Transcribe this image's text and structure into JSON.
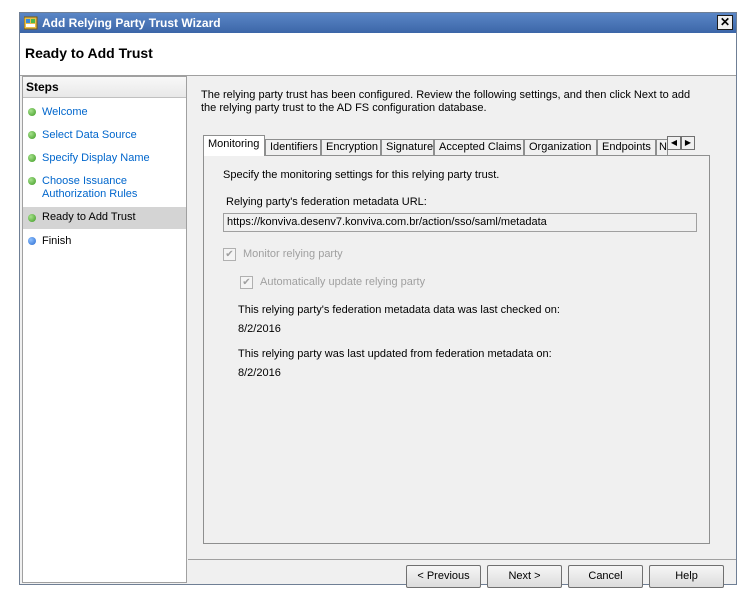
{
  "window": {
    "title": "Add Relying Party Trust Wizard",
    "close_glyph": "✕",
    "icon": "wizard-icon"
  },
  "header": {
    "title": "Ready to Add Trust"
  },
  "steps": {
    "heading": "Steps",
    "items": [
      {
        "label": "Welcome",
        "status": "done"
      },
      {
        "label": "Select Data Source",
        "status": "done"
      },
      {
        "label": "Specify Display Name",
        "status": "done"
      },
      {
        "label": "Choose Issuance\nAuthorization Rules",
        "status": "done"
      },
      {
        "label": "Ready to Add Trust",
        "status": "current"
      },
      {
        "label": "Finish",
        "status": "pending"
      }
    ]
  },
  "main": {
    "intro": "The relying party trust has been configured. Review the following settings, and then click Next to add the relying party trust to the AD FS configuration database.",
    "tabs": [
      "Monitoring",
      "Identifiers",
      "Encryption",
      "Signature",
      "Accepted Claims",
      "Organization",
      "Endpoints",
      "N"
    ],
    "selected_tab": "Monitoring",
    "tab_scroll_left": "◀",
    "tab_scroll_right": "▶",
    "monitoring": {
      "description": "Specify the monitoring settings for this relying party trust.",
      "url_label": "Relying party's federation metadata URL:",
      "url_value": "https://konviva.desenv7.konviva.com.br/action/sso/saml/metadata",
      "monitor_label": "Monitor relying party",
      "monitor_checked": true,
      "auto_update_label": "Automatically update relying party",
      "auto_update_checked": true,
      "last_checked_label": "This relying party's federation metadata data was last checked on:",
      "last_checked_value": "8/2/2016",
      "last_updated_label": "This relying party was last updated from federation metadata on:",
      "last_updated_value": "8/2/2016",
      "check_glyph": "✔"
    }
  },
  "buttons": {
    "previous": "< Previous",
    "next": "Next >",
    "cancel": "Cancel",
    "help": "Help"
  },
  "colors": {
    "link": "#0066cc",
    "title_bar": "#4a76b8",
    "done_dot": "#3d9a22",
    "pending_dot": "#2a6cd0"
  }
}
